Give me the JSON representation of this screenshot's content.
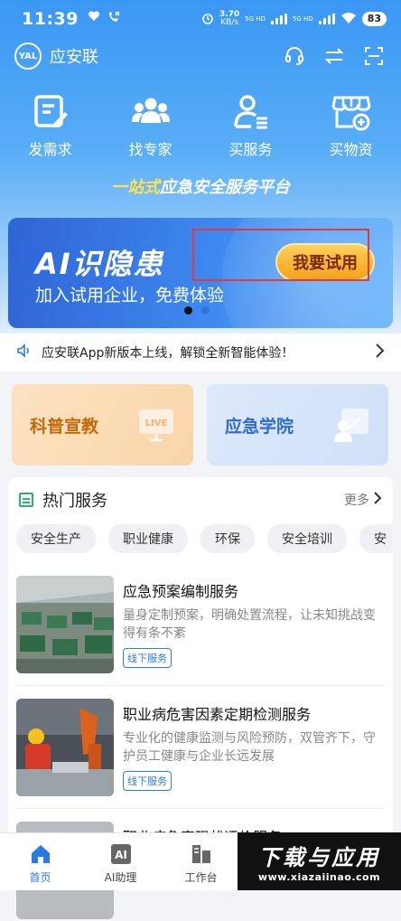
{
  "status_bar": {
    "time": "11:39",
    "net_speed_value": "3.70",
    "net_speed_unit": "KB/s",
    "sim1": "5G HD",
    "sim2": "5G HD",
    "battery": "83"
  },
  "header": {
    "app_name": "应安联",
    "logo_text": "YAL"
  },
  "quick_entries": [
    {
      "label": "发需求",
      "icon": "edit-document-icon"
    },
    {
      "label": "找专家",
      "icon": "group-icon"
    },
    {
      "label": "买服务",
      "icon": "person-list-icon"
    },
    {
      "label": "买物资",
      "icon": "store-add-icon"
    }
  ],
  "slogan": {
    "highlight": "一站式",
    "rest": "应急安全服务平台"
  },
  "banner": {
    "title": "AI识隐患",
    "subtitle": "加入试用企业，免费体验",
    "button": "我要试用",
    "page_count": 2,
    "active_page": 1
  },
  "notice": {
    "text": "应安联App新版本上线，解锁全新智能体验！"
  },
  "cards": [
    {
      "label": "科普宣教",
      "icon": "live-tv-icon"
    },
    {
      "label": "应急学院",
      "icon": "teacher-board-icon"
    }
  ],
  "services": {
    "title": "热门服务",
    "more": "更多",
    "tags": [
      "安全生产",
      "职业健康",
      "环保",
      "安全培训",
      "安"
    ],
    "items": [
      {
        "name": "应急预案编制服务",
        "desc": "量身定制预案，明确处置流程，让未知挑战变得有条不紊",
        "badge": "线下服务"
      },
      {
        "name": "职业病危害因素定期检测服务",
        "desc": "专业化的健康监测与风险预防，双管齐下，守护员工健康与企业长远发展",
        "badge": "线下服务"
      },
      {
        "name": "职业病危害现状评价服务",
        "desc": "",
        "badge": ""
      }
    ]
  },
  "tabbar": [
    {
      "label": "首页",
      "icon": "home-icon",
      "active": true
    },
    {
      "label": "AI助理",
      "icon": "ai-icon",
      "active": false
    },
    {
      "label": "工作台",
      "icon": "workbench-icon",
      "active": false
    }
  ],
  "watermark": {
    "main": "下载与应用",
    "url": "www.xiazaiinao.com"
  },
  "colors": {
    "primary": "#3a97f3",
    "accent_orange": "#f5a21d",
    "highlight_red": "#e53935",
    "tab_active": "#2a7ae4"
  }
}
